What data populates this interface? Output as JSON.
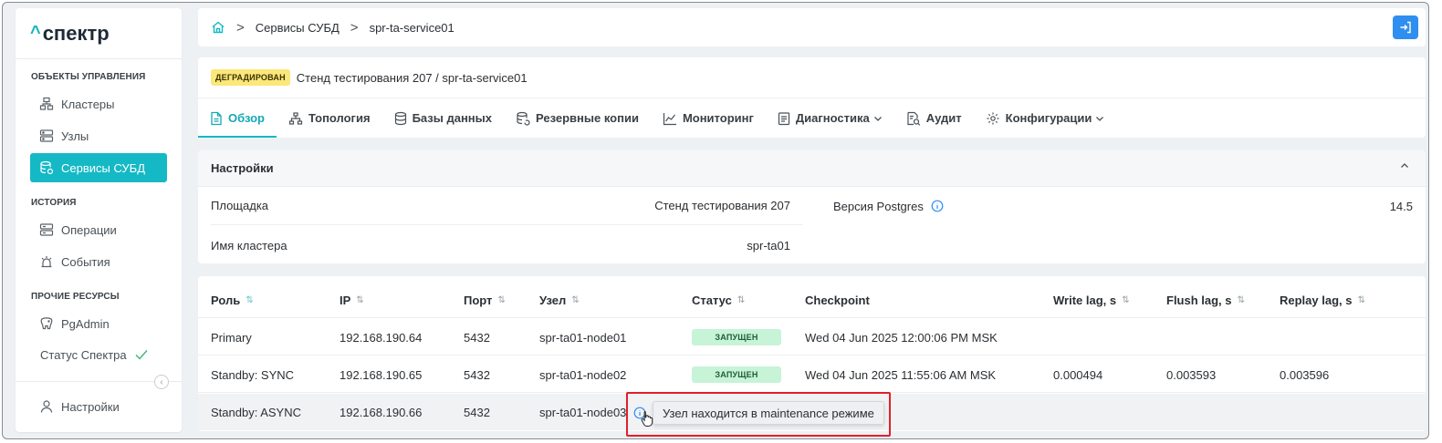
{
  "app": {
    "logo_caret": "^",
    "logo_text": "спектр"
  },
  "sidebar": {
    "section_objects": "ОБЪЕКТЫ УПРАВЛЕНИЯ",
    "clusters": "Кластеры",
    "nodes": "Узлы",
    "dbms_services": "Сервисы СУБД",
    "section_history": "ИСТОРИЯ",
    "operations": "Операции",
    "events": "События",
    "section_other": "ПРОЧИЕ РЕСУРСЫ",
    "pgadmin": "PgAdmin",
    "spectr_status": "Статус Спектра",
    "settings": "Настройки",
    "collapse_glyph": "‹"
  },
  "breadcrumb": {
    "item1": "Сервисы СУБД",
    "item2": "spr-ta-service01",
    "sep": ">"
  },
  "header": {
    "status_badge": "ДЕГРАДИРОВАН",
    "title": "Стенд тестирования 207 /  spr-ta-service01"
  },
  "tabs": {
    "overview": "Обзор",
    "topology": "Топология",
    "databases": "Базы данных",
    "backups": "Резервные копии",
    "monitoring": "Мониторинг",
    "diagnostics": "Диагностика",
    "audit": "Аудит",
    "configurations": "Конфигурации"
  },
  "settings_panel": {
    "title": "Настройки",
    "site_label": "Площадка",
    "site_value": "Стенд тестирования 207",
    "cluster_label": "Имя кластера",
    "cluster_value": "spr-ta01",
    "pg_version_label": "Версия Postgres",
    "pg_version_value": "14.5"
  },
  "table": {
    "columns": {
      "role": "Роль",
      "ip": "IP",
      "port": "Порт",
      "node": "Узел",
      "status": "Статус",
      "checkpoint": "Checkpoint",
      "write_lag": "Write lag, s",
      "flush_lag": "Flush lag, s",
      "replay_lag": "Replay lag, s"
    },
    "sort_glyph": "⇅",
    "rows": [
      {
        "role": "Primary",
        "ip": "192.168.190.64",
        "port": "5432",
        "node": "spr-ta01-node01",
        "status": "ЗАПУЩЕН",
        "checkpoint": "Wed 04 Jun 2025 12:00:06 PM MSK",
        "write_lag": "",
        "flush_lag": "",
        "replay_lag": ""
      },
      {
        "role": "Standby: SYNC",
        "ip": "192.168.190.65",
        "port": "5432",
        "node": "spr-ta01-node02",
        "status": "ЗАПУЩЕН",
        "checkpoint": "Wed 04 Jun 2025 11:55:06 AM MSK",
        "write_lag": "0.000494",
        "flush_lag": "0.003593",
        "replay_lag": "0.003596"
      },
      {
        "role": "Standby: ASYNC",
        "ip": "192.168.190.66",
        "port": "5432",
        "node": "spr-ta01-node03",
        "status": "",
        "checkpoint": "",
        "write_lag": "",
        "flush_lag": "",
        "replay_lag": ""
      }
    ]
  },
  "tooltip": {
    "text": "Узел находится в maintenance режиме"
  },
  "colors": {
    "accent": "#15b9c5",
    "degraded": "#fbe77a",
    "running": "#c7f3d7",
    "highlight": "#e0202a",
    "logout": "#2f8ff0"
  }
}
